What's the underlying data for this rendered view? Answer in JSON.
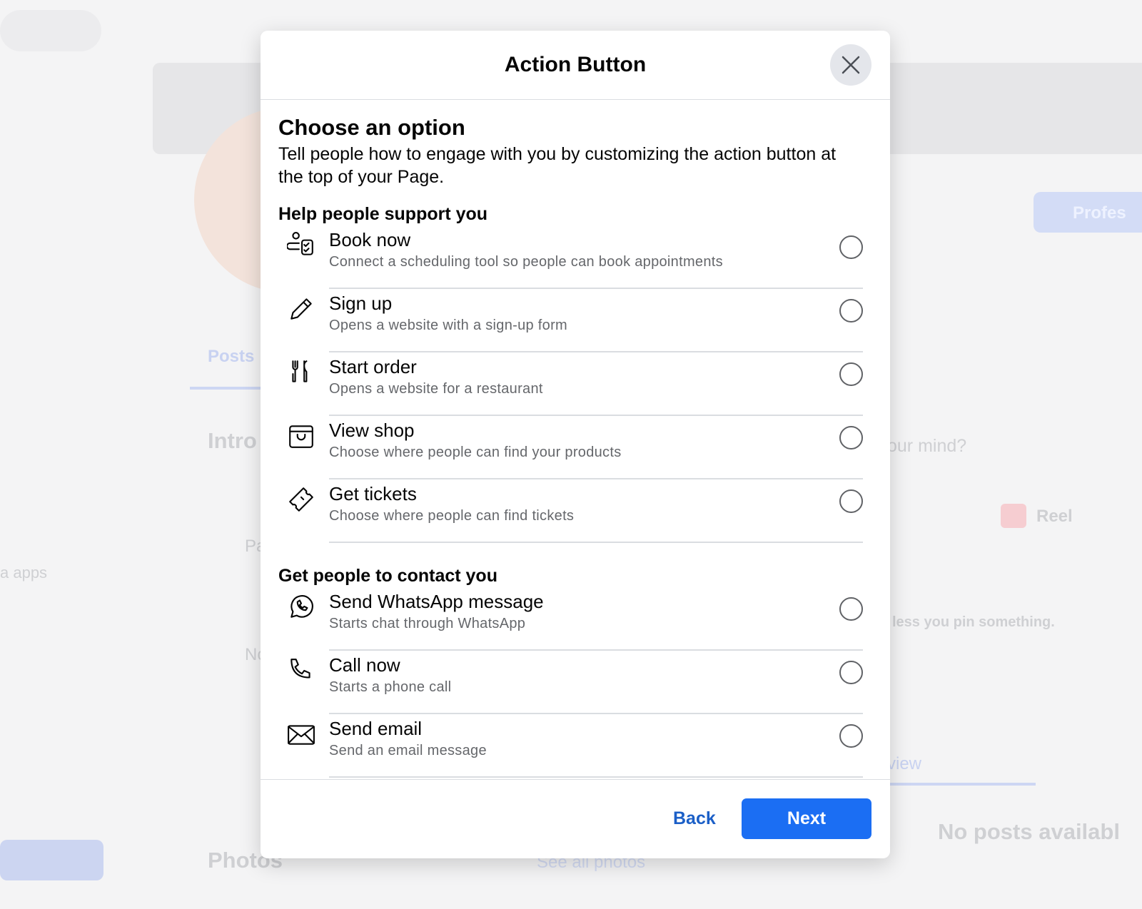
{
  "background": {
    "posts_tab": "Posts",
    "intro": "Intro",
    "photos": "Photos",
    "see_all_photos": "See all photos",
    "apps": "a apps",
    "mind": "our mind?",
    "reel": "Reel",
    "pin": "less you pin something.",
    "view": "view",
    "no_posts": "No posts availabl",
    "professional": "Profes",
    "pa": "Pa",
    "no": "No"
  },
  "modal": {
    "title": "Action Button",
    "heading": "Choose an option",
    "description": "Tell people how to engage with you by customizing the action button at the top of your Page.",
    "sections": [
      {
        "title": "Help people support you",
        "options": [
          {
            "icon": "book-calendar-icon",
            "label": "Book now",
            "desc": "Connect a scheduling tool so people can book appointments",
            "selected": false
          },
          {
            "icon": "pencil-icon",
            "label": "Sign up",
            "desc": "Opens a website with a sign-up form",
            "selected": false
          },
          {
            "icon": "fork-knife-icon",
            "label": "Start order",
            "desc": "Opens a website for a restaurant",
            "selected": false
          },
          {
            "icon": "shopping-bag-icon",
            "label": "View shop",
            "desc": "Choose where people can find your products",
            "selected": false
          },
          {
            "icon": "ticket-icon",
            "label": "Get tickets",
            "desc": "Choose where people can find tickets",
            "selected": false
          }
        ]
      },
      {
        "title": "Get people to contact you",
        "options": [
          {
            "icon": "whatsapp-icon",
            "label": "Send WhatsApp message",
            "desc": "Starts chat through WhatsApp",
            "selected": false
          },
          {
            "icon": "phone-icon",
            "label": "Call now",
            "desc": "Starts a phone call",
            "selected": false
          },
          {
            "icon": "envelope-icon",
            "label": "Send email",
            "desc": "Send an email message",
            "selected": false
          }
        ]
      }
    ],
    "back": "Back",
    "next": "Next"
  },
  "colors": {
    "primary": "#1b6ef3",
    "link": "#1b5fc7"
  }
}
